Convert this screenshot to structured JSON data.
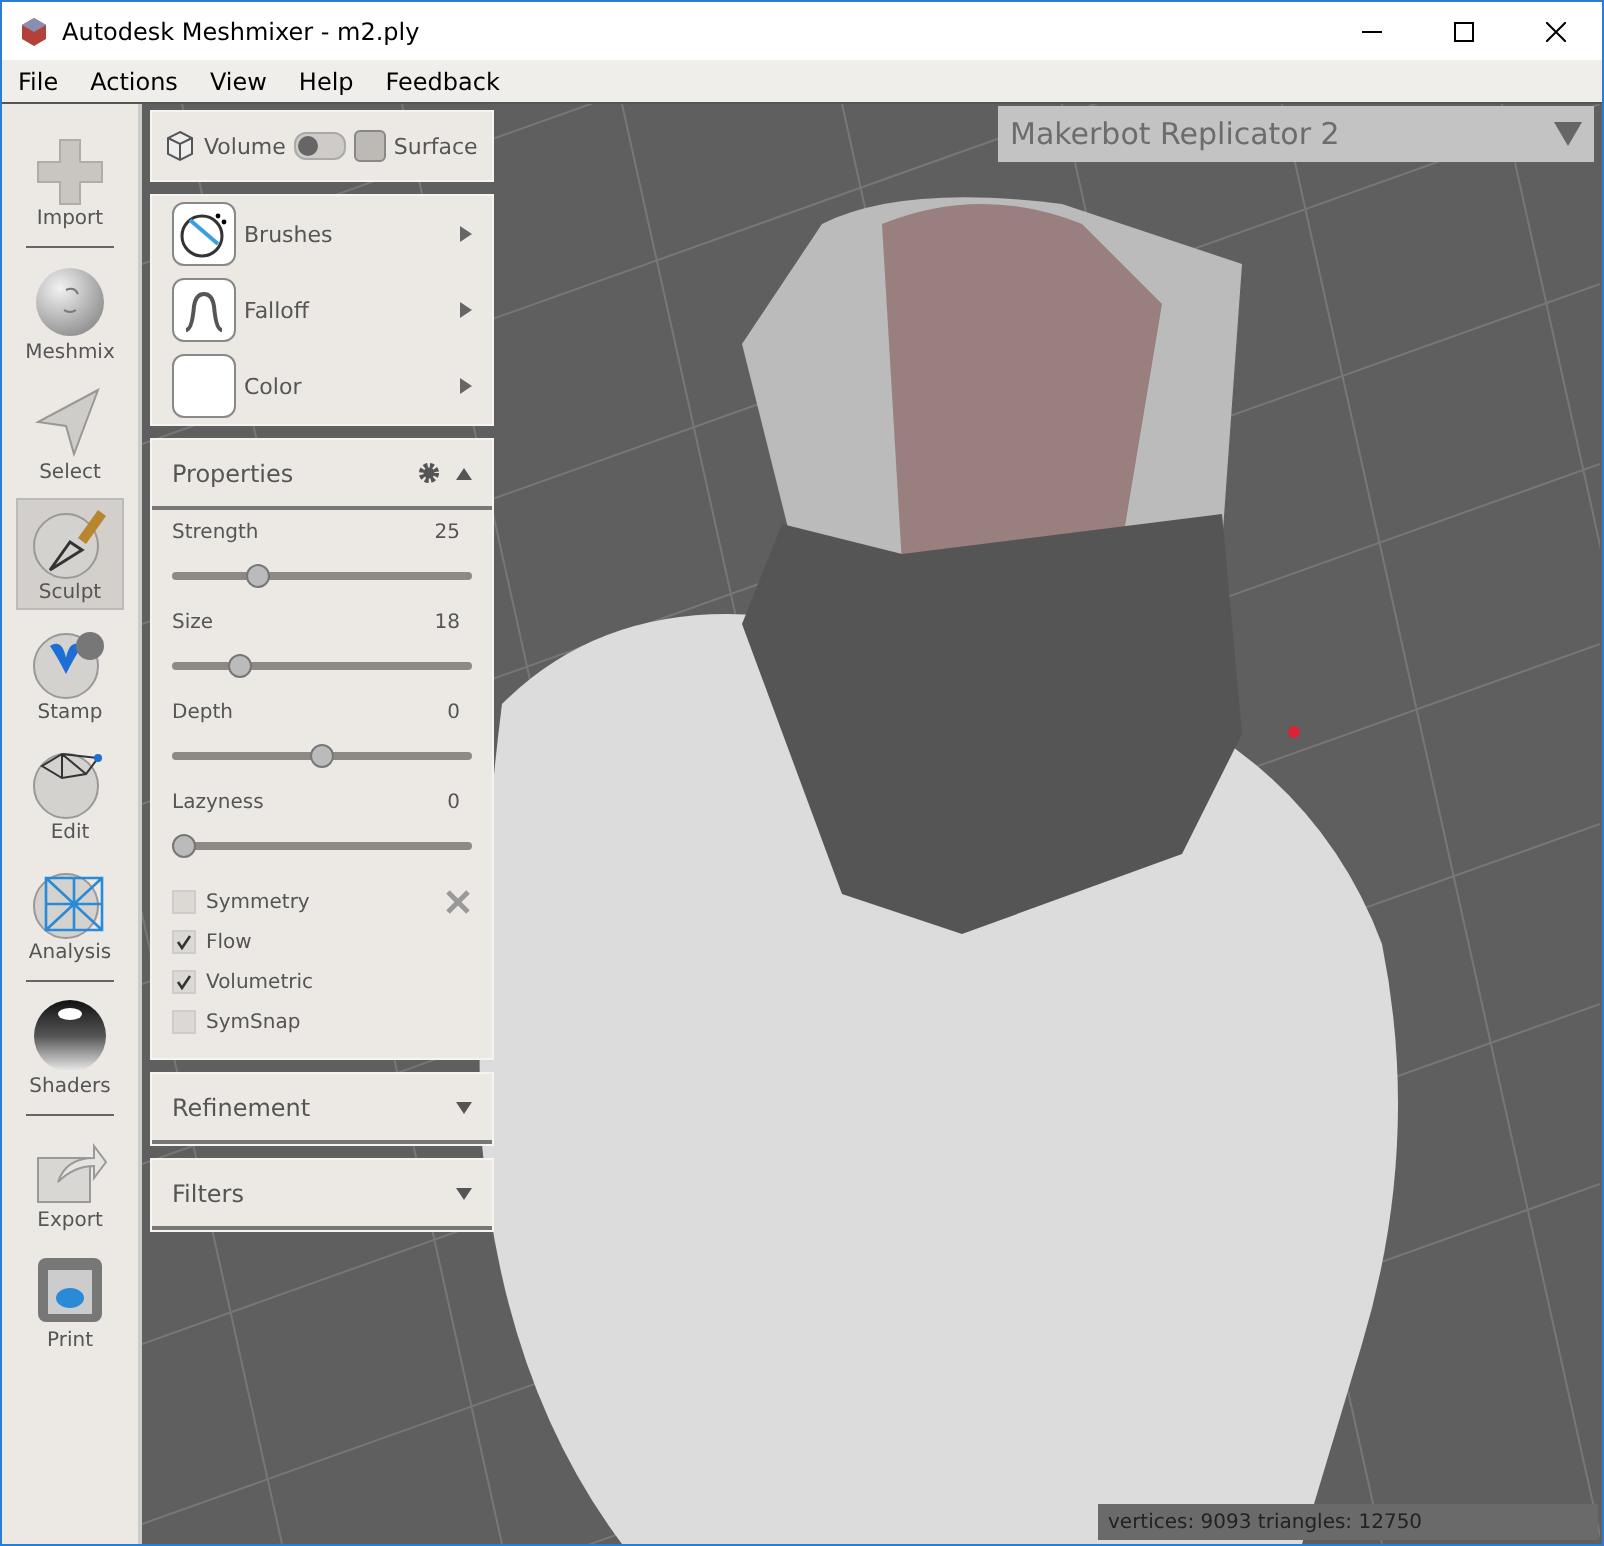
{
  "window": {
    "title": "Autodesk Meshmixer - m2.ply"
  },
  "menu": [
    "File",
    "Actions",
    "View",
    "Help",
    "Feedback"
  ],
  "tool_groups": [
    [
      {
        "label": "Import",
        "selected": false
      }
    ],
    [
      {
        "label": "Meshmix",
        "selected": false
      },
      {
        "label": "Select",
        "selected": false
      },
      {
        "label": "Sculpt",
        "selected": true
      },
      {
        "label": "Stamp",
        "selected": false
      },
      {
        "label": "Edit",
        "selected": false
      },
      {
        "label": "Analysis",
        "selected": false
      }
    ],
    [
      {
        "label": "Shaders",
        "selected": false
      }
    ],
    [
      {
        "label": "Export",
        "selected": false
      },
      {
        "label": "Print",
        "selected": false
      }
    ]
  ],
  "mode": {
    "volume_label": "Volume",
    "surface_label": "Surface",
    "on": false
  },
  "brush_items": [
    {
      "label": "Brushes"
    },
    {
      "label": "Falloff"
    },
    {
      "label": "Color"
    }
  ],
  "properties": {
    "title": "Properties",
    "expanded": true,
    "sliders": [
      {
        "label": "Strength",
        "reading": "25",
        "level": 0.27
      },
      {
        "label": "Size",
        "reading": "18",
        "level": 0.2
      },
      {
        "label": "Depth",
        "reading": "0",
        "level": 0.5
      },
      {
        "label": "Lazyness",
        "reading": "0",
        "level": 0.0
      }
    ],
    "options": [
      {
        "label": "Symmetry",
        "checked": false
      },
      {
        "label": "Flow",
        "checked": true
      },
      {
        "label": "Volumetric",
        "checked": true
      },
      {
        "label": "SymSnap",
        "checked": false
      }
    ]
  },
  "sections": [
    {
      "title": "Refinement",
      "expanded": false
    },
    {
      "title": "Filters",
      "expanded": false
    }
  ],
  "printer": "Makerbot Replicator 2",
  "status_bar": "vertices: 9093 triangles: 12750"
}
